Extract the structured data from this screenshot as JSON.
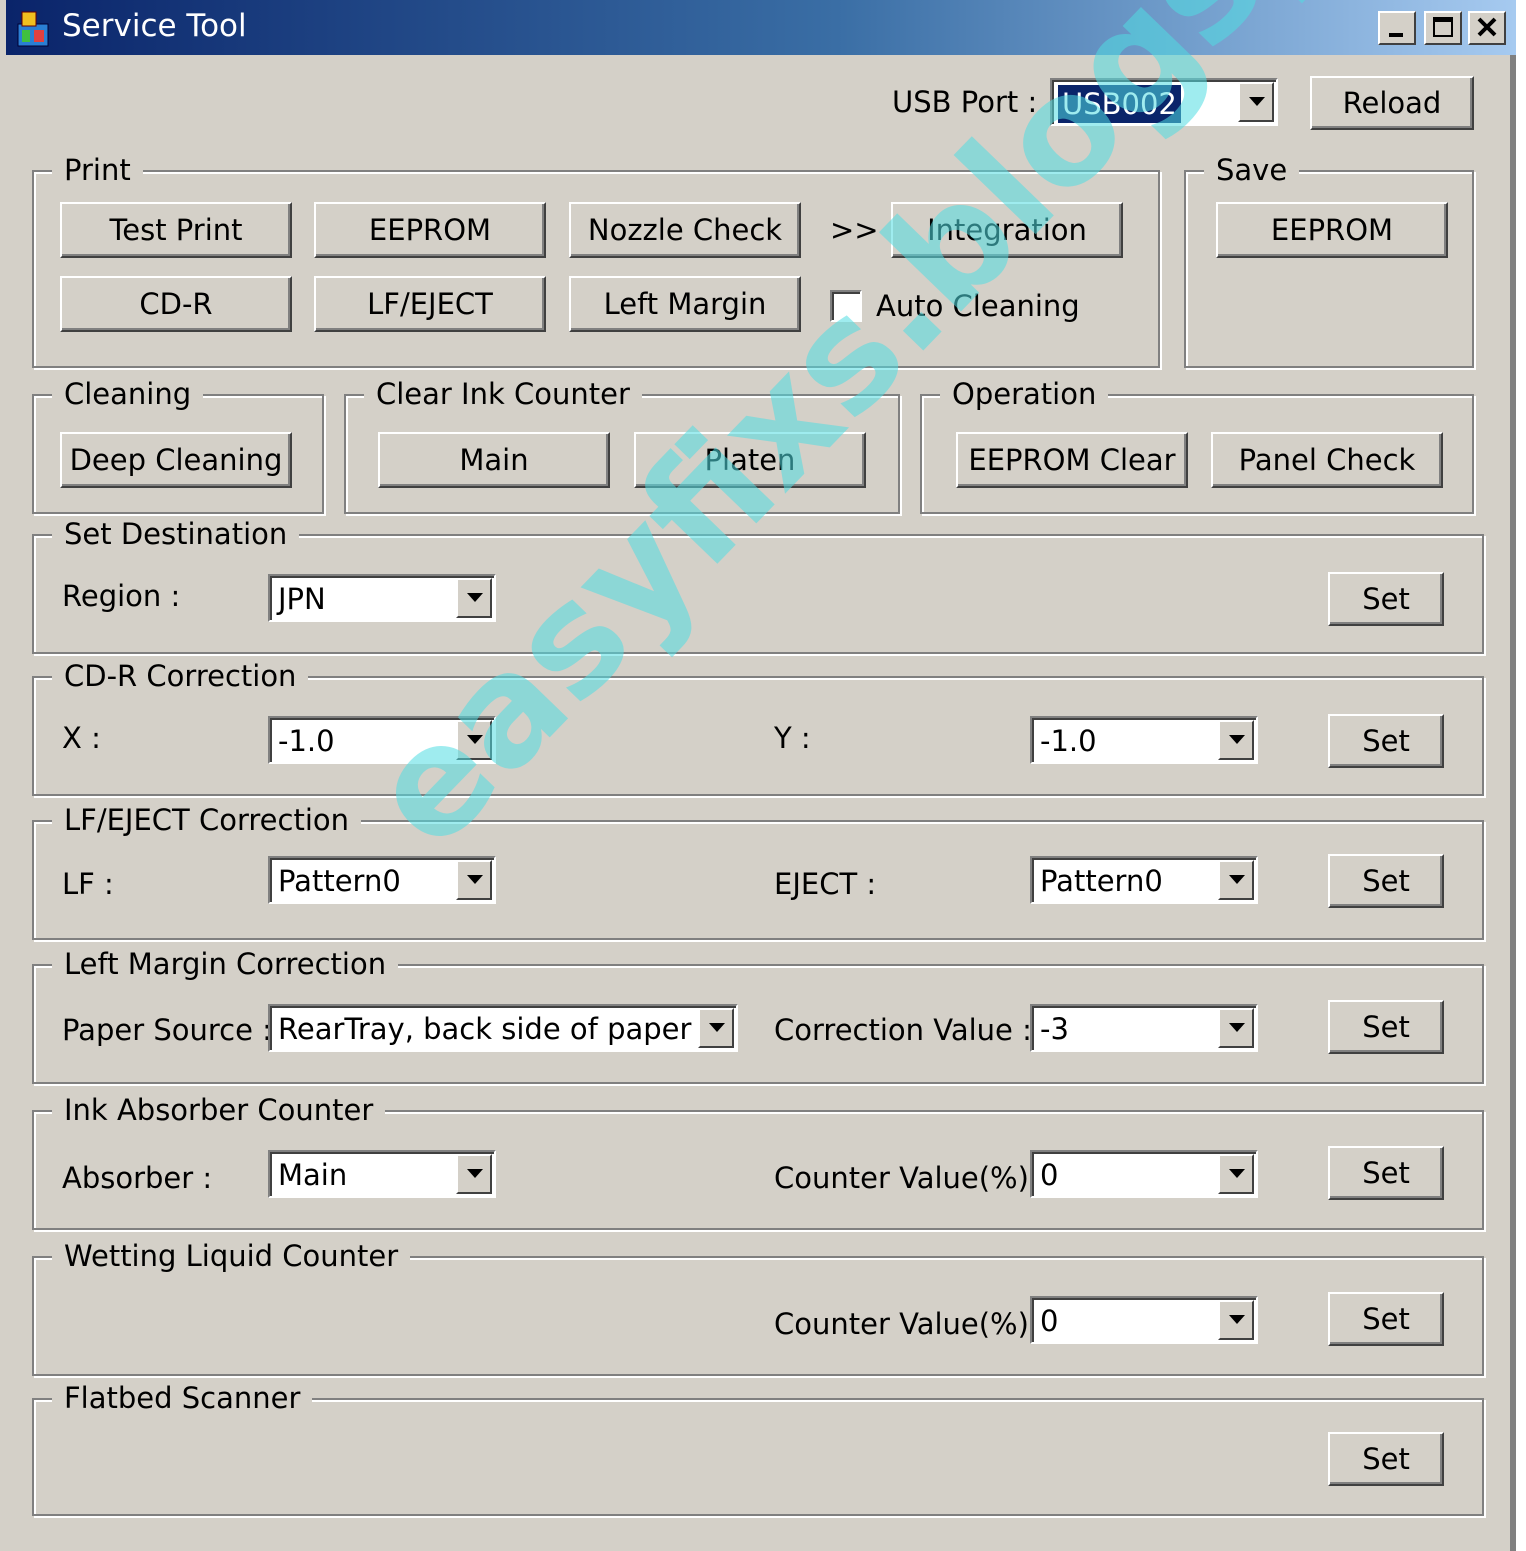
{
  "window": {
    "title": "Service Tool",
    "controls": [
      "minimize-icon",
      "maximize-icon",
      "close-icon"
    ]
  },
  "usb": {
    "label": "USB Port :",
    "value": "USB002",
    "reload": "Reload"
  },
  "print": {
    "legend": "Print",
    "test_print": "Test Print",
    "eeprom": "EEPROM",
    "nozzle_check": "Nozzle Check",
    "arrow": ">>",
    "integration": "Integration",
    "cdr": "CD-R",
    "lf_eject": "LF/EJECT",
    "left_margin": "Left Margin",
    "auto_cleaning": "Auto Cleaning",
    "auto_cleaning_checked": false
  },
  "save": {
    "legend": "Save",
    "eeprom": "EEPROM"
  },
  "cleaning": {
    "legend": "Cleaning",
    "deep": "Deep Cleaning"
  },
  "clear_ink": {
    "legend": "Clear Ink Counter",
    "main": "Main",
    "platen": "Platen"
  },
  "operation": {
    "legend": "Operation",
    "eeprom_clear": "EEPROM Clear",
    "panel_check": "Panel Check"
  },
  "destination": {
    "legend": "Set Destination",
    "region_label": "Region :",
    "region_value": "JPN",
    "set": "Set"
  },
  "cdr_corr": {
    "legend": "CD-R Correction",
    "x_label": "X :",
    "x_value": "-1.0",
    "y_label": "Y :",
    "y_value": "-1.0",
    "set": "Set"
  },
  "lf_corr": {
    "legend": "LF/EJECT Correction",
    "lf_label": "LF :",
    "lf_value": "Pattern0",
    "eject_label": "EJECT :",
    "eject_value": "Pattern0",
    "set": "Set"
  },
  "margin_corr": {
    "legend": "Left Margin Correction",
    "source_label": "Paper Source :",
    "source_value": "RearTray, back side of paper",
    "value_label": "Correction Value :",
    "value": "-3",
    "set": "Set"
  },
  "ink_absorber": {
    "legend": "Ink Absorber Counter",
    "absorber_label": "Absorber :",
    "absorber_value": "Main",
    "counter_label": "Counter Value(%) :",
    "counter_value": "0",
    "set": "Set"
  },
  "wetting": {
    "legend": "Wetting Liquid Counter",
    "counter_label": "Counter Value(%) :",
    "counter_value": "0",
    "set": "Set"
  },
  "scanner": {
    "legend": "Flatbed Scanner",
    "set": "Set"
  },
  "watermark": "easyfixs.blogspot.com"
}
